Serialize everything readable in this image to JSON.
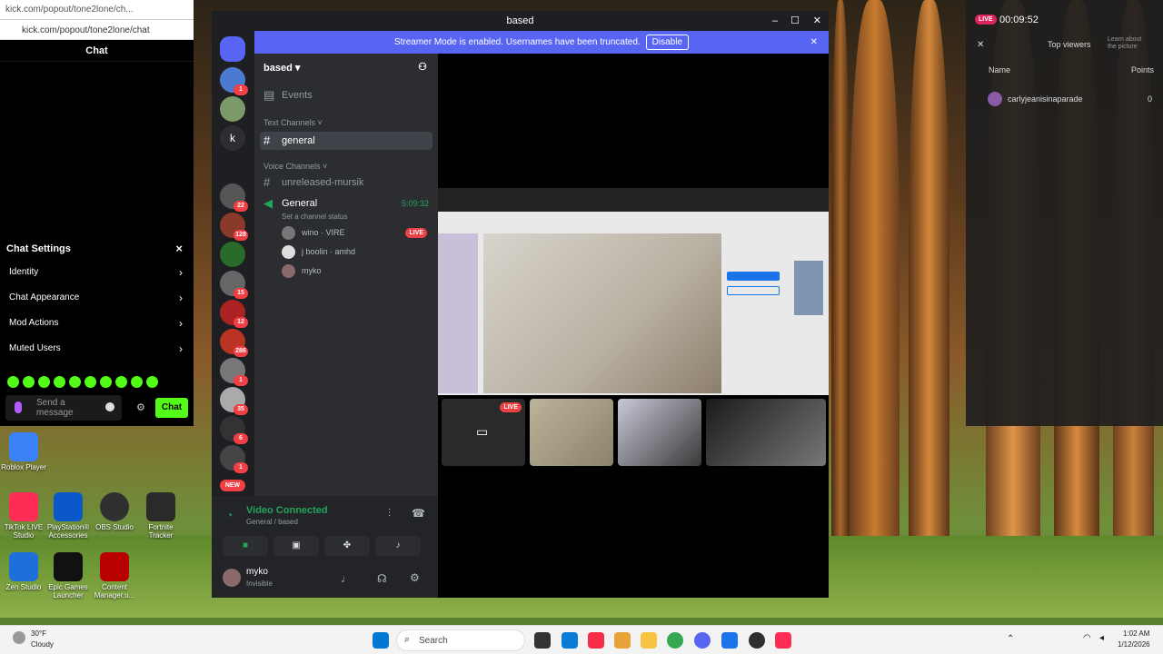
{
  "kick": {
    "browser_title": "kick.com/popout/tone2lone/ch...",
    "url": "kick.com/popout/tone2lone/chat",
    "header": "Chat",
    "settings_title": "Chat Settings",
    "settings_items": [
      "Identity",
      "Chat Appearance",
      "Mod Actions",
      "Muted Users"
    ],
    "input_placeholder": "Send a message",
    "chat_button": "Chat"
  },
  "desktop_icons": [
    {
      "label": "Roblox Player",
      "color": "#3b82f6"
    },
    {
      "label": "TikTok LIVE Studio",
      "color": "#ff2d55"
    },
    {
      "label": "PlayStation® Accessories",
      "color": "#0a58ca"
    },
    {
      "label": "OBS Studio",
      "color": "#303030"
    },
    {
      "label": "Fortnite Tracker",
      "color": "#2a2a2a"
    },
    {
      "label": "Zen Studio",
      "color": "#1e6fd9"
    },
    {
      "label": "Epic Games Launcher",
      "color": "#111111"
    },
    {
      "label": "Content Manager.u...",
      "color": "#b80000"
    }
  ],
  "discord": {
    "window_title": "based",
    "banner_text": "Streamer Mode is enabled. Usernames have been truncated.",
    "banner_button": "Disable",
    "server_name": "based",
    "events": "Events",
    "text_category": "Text Channels",
    "text_channel": "general",
    "voice_category": "Voice Channels",
    "voice_channels": [
      "unreleased-mursik",
      "General"
    ],
    "call_time": "5:09:32",
    "channel_status": "Set a channel status",
    "voice_users": [
      {
        "name": "wino",
        "tag": "VIRE",
        "live": "LIVE"
      },
      {
        "name": "j boolin",
        "tag": "amhd",
        "live": ""
      },
      {
        "name": "myko",
        "tag": "",
        "live": ""
      }
    ],
    "guild_badges": [
      "1",
      "22",
      "128",
      "15",
      "12",
      "286",
      "1",
      "35",
      "6",
      "1"
    ],
    "new_badge": "NEW",
    "video_connected": "Video Connected",
    "video_sub": "General / based",
    "user_name": "myko",
    "user_status": "Invisible",
    "tile_live": "LIVE"
  },
  "kick_panel": {
    "live_label": "LIVE",
    "timer": "00:09:52",
    "top_viewers": "Top viewers",
    "learn_more": "Learn about the picture",
    "col_name": "Name",
    "col_points": "Points",
    "viewer_name": "carlyjeanisinaparade",
    "viewer_points": "0"
  },
  "taskbar": {
    "weather_temp": "30°F",
    "weather_desc": "Cloudy",
    "search_placeholder": "Search",
    "time": "1:02 AM",
    "date": "1/12/2026"
  }
}
